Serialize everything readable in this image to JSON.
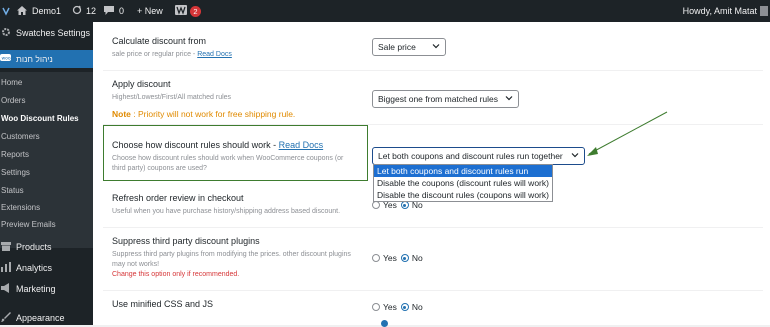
{
  "adminbar": {
    "site_name": "Demo1",
    "updates_count": "12",
    "comments_count": "0",
    "new_label": "+ New",
    "plugin_badge": "2",
    "howdy": "Howdy, Amit Matat"
  },
  "sidebar": {
    "swatches": "Swatches Settings",
    "hebrew": "ניהול חנות",
    "sub_items": [
      "Home",
      "Orders",
      "Woo Discount Rules",
      "Customers",
      "Reports",
      "Settings",
      "Status",
      "Extensions",
      "Preview Emails"
    ],
    "products": "Products",
    "analytics": "Analytics",
    "marketing": "Marketing",
    "appearance": "Appearance"
  },
  "settings": {
    "calc_title": "Calculate discount from",
    "calc_desc": "sale price or regular price - ",
    "calc_link": "Read Docs",
    "calc_value": "Sale price",
    "apply_title": "Apply discount",
    "apply_desc": "Highest/Lowest/First/All matched rules",
    "apply_note_label": "Note",
    "apply_note_text": " : Priority will not work for free shipping rule.",
    "apply_value": "Biggest one from matched rules",
    "choose_title": "Choose how discount rules should work - ",
    "choose_link": "Read Docs",
    "choose_desc": "Choose how discount rules should work when WooCommerce coupons (or third party) coupons are used?",
    "choose_value": "Let both coupons and discount rules run together",
    "choose_options": [
      "Let both coupons and discount rules run together",
      "Disable the coupons (discount rules will work)",
      "Disable the discount rules (coupons will work)"
    ],
    "refresh_title": "Refresh order review in checkout",
    "refresh_desc": "Useful when you have purchase history/shipping address based discount.",
    "suppress_title": "Suppress third party discount plugins",
    "suppress_desc": "Suppress third party plugins from modifying the prices. other discount plugins may not works!",
    "suppress_warn": "Change this option only if recommended.",
    "minified_title": "Use minified CSS and JS",
    "yes": "Yes",
    "no": "No"
  }
}
